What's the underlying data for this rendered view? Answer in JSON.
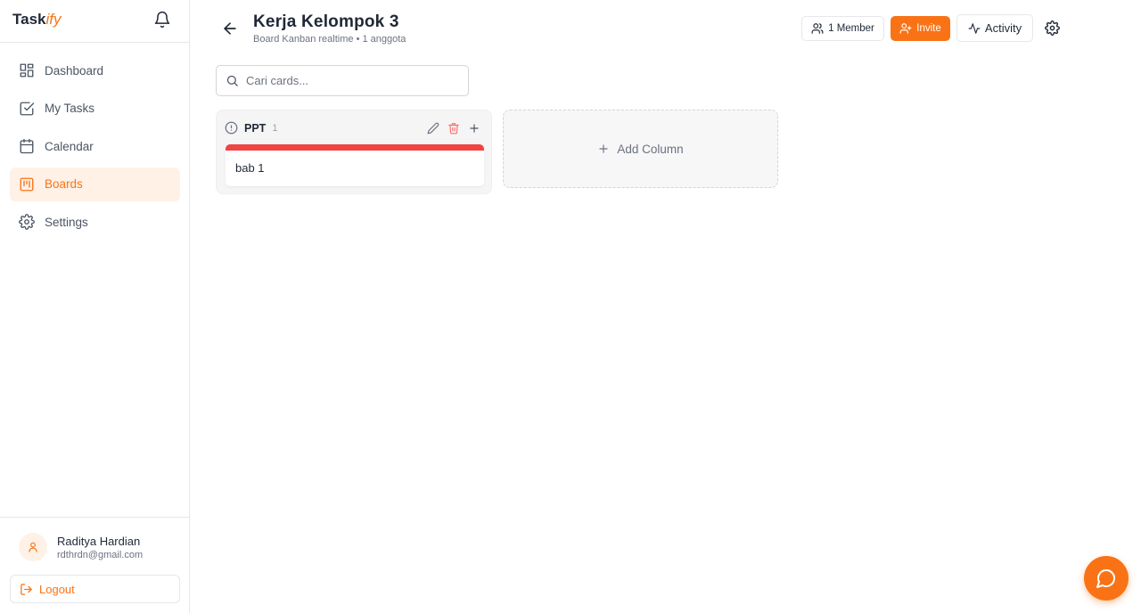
{
  "brand": {
    "name_main": "Task",
    "name_accent": "ify"
  },
  "sidebar": {
    "items": [
      {
        "label": "Dashboard",
        "icon": "grid-icon",
        "active": false
      },
      {
        "label": "My Tasks",
        "icon": "checkbox-icon",
        "active": false
      },
      {
        "label": "Calendar",
        "icon": "calendar-icon",
        "active": false
      },
      {
        "label": "Boards",
        "icon": "kanban-icon",
        "active": true
      },
      {
        "label": "Settings",
        "icon": "gear-icon",
        "active": false
      }
    ],
    "user": {
      "name": "Raditya Hardian",
      "email": "rdthrdn@gmail.com"
    },
    "logout_label": "Logout"
  },
  "header": {
    "title": "Kerja Kelompok 3",
    "subtitle": "Board Kanban realtime • 1 anggota",
    "member_label": "1 Member",
    "invite_label": "Invite",
    "activity_label": "Activity"
  },
  "search": {
    "placeholder": "Cari cards...",
    "value": ""
  },
  "board": {
    "columns": [
      {
        "title": "PPT",
        "count": "1",
        "cards": [
          {
            "title": "bab 1",
            "color": "#ef4444"
          }
        ]
      }
    ],
    "add_column_label": "Add Column"
  },
  "colors": {
    "accent": "#f97316",
    "active_bg": "#fff1e6",
    "card_bar": "#ef4444"
  }
}
